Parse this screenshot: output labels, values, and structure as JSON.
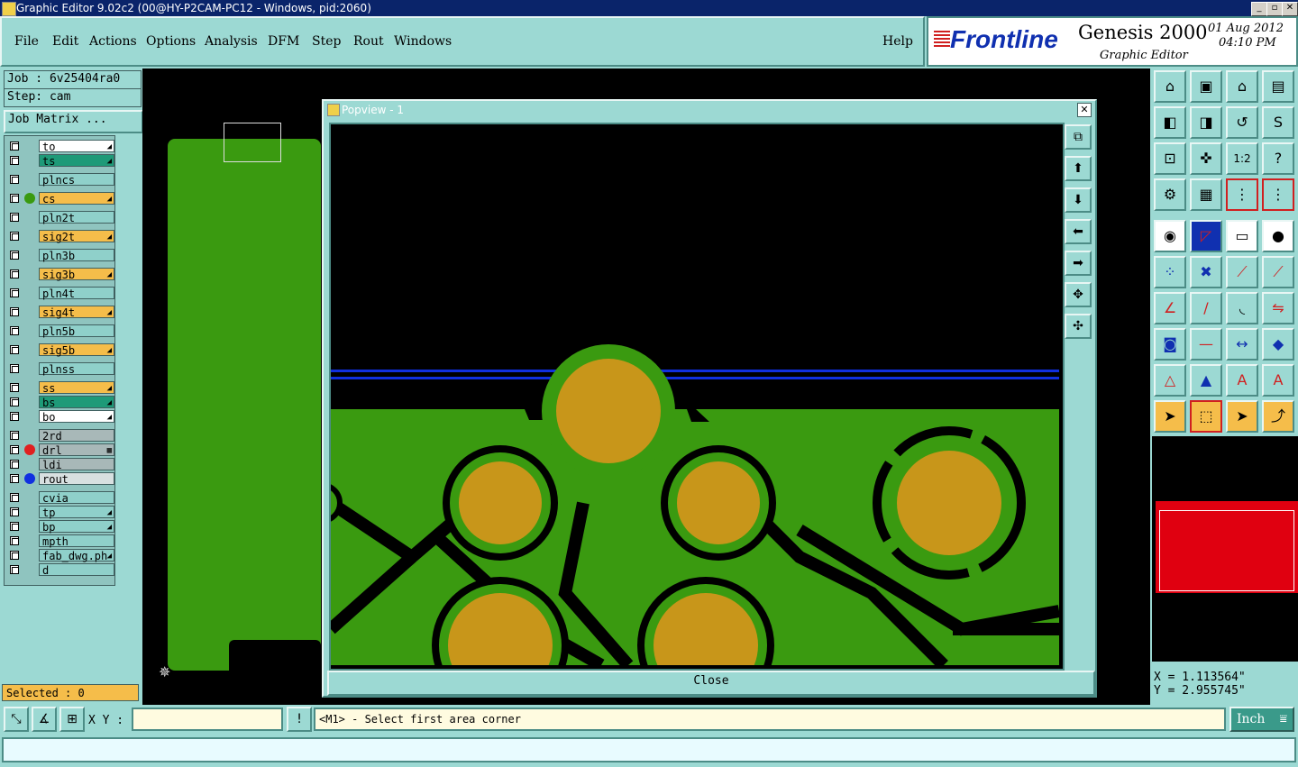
{
  "window": {
    "title": "Graphic Editor 9.02c2 (00@HY-P2CAM-PC12 - Windows, pid:2060)"
  },
  "menu": [
    "File",
    "Edit",
    "Actions",
    "Options",
    "Analysis",
    "DFM",
    "Step",
    "Rout",
    "Windows"
  ],
  "help_label": "Help",
  "brand": {
    "logo": "Frontline",
    "product": "Genesis 2000",
    "subtitle": "Graphic Editor",
    "date": "01 Aug 2012",
    "time": "04:10 PM"
  },
  "job": {
    "job_line": "Job : 6v25404ra0",
    "step_line": "Step: cam",
    "matrix_label": "Job Matrix ..."
  },
  "layers": [
    {
      "name": "to",
      "bg": "#ffffff",
      "dot": "",
      "mark": "◢"
    },
    {
      "name": "ts",
      "bg": "#1e9a78",
      "dot": "",
      "mark": "◢"
    },
    {
      "name": "plncs",
      "bg": "#8fd0ca",
      "dot": "",
      "mark": ""
    },
    {
      "name": "cs",
      "bg": "#f5bd4a",
      "dot": "#3a9a10",
      "mark": "◢"
    },
    {
      "name": "pln2t",
      "bg": "#8fd0ca",
      "dot": "",
      "mark": ""
    },
    {
      "name": "sig2t",
      "bg": "#f5bd4a",
      "dot": "",
      "mark": "◢"
    },
    {
      "name": "pln3b",
      "bg": "#8fd0ca",
      "dot": "",
      "mark": ""
    },
    {
      "name": "sig3b",
      "bg": "#f5bd4a",
      "dot": "",
      "mark": "◢"
    },
    {
      "name": "pln4t",
      "bg": "#8fd0ca",
      "dot": "",
      "mark": ""
    },
    {
      "name": "sig4t",
      "bg": "#f5bd4a",
      "dot": "",
      "mark": "◢"
    },
    {
      "name": "pln5b",
      "bg": "#8fd0ca",
      "dot": "",
      "mark": ""
    },
    {
      "name": "sig5b",
      "bg": "#f5bd4a",
      "dot": "",
      "mark": "◢"
    },
    {
      "name": "plnss",
      "bg": "#8fd0ca",
      "dot": "",
      "mark": ""
    },
    {
      "name": "ss",
      "bg": "#f5bd4a",
      "dot": "",
      "mark": "◢"
    },
    {
      "name": "bs",
      "bg": "#1e9a78",
      "dot": "",
      "mark": "◢"
    },
    {
      "name": "bo",
      "bg": "#ffffff",
      "dot": "",
      "mark": "◢"
    },
    {
      "name": "2rd",
      "bg": "#a8b8b8",
      "dot": "",
      "mark": ""
    },
    {
      "name": "drl",
      "bg": "#a8b8b8",
      "dot": "#e02020",
      "mark": "▦"
    },
    {
      "name": "ldi",
      "bg": "#a8b8b8",
      "dot": "",
      "mark": ""
    },
    {
      "name": "rout",
      "bg": "#d8e0e0",
      "dot": "#1030e0",
      "mark": ""
    },
    {
      "name": "cvia",
      "bg": "#8fd0ca",
      "dot": "",
      "mark": ""
    },
    {
      "name": "tp",
      "bg": "#8fd0ca",
      "dot": "",
      "mark": "◢"
    },
    {
      "name": "bp",
      "bg": "#8fd0ca",
      "dot": "",
      "mark": "◢"
    },
    {
      "name": "mpth",
      "bg": "#8fd0ca",
      "dot": "",
      "mark": ""
    },
    {
      "name": "fab_dwg.ph",
      "bg": "#8fd0ca",
      "dot": "",
      "mark": "◢"
    },
    {
      "name": "d",
      "bg": "#8fd0ca",
      "dot": "",
      "mark": ""
    }
  ],
  "selected": "Selected : 0",
  "popup": {
    "title": "Popview - 1",
    "close_label": "Close"
  },
  "coords": {
    "x": "X = 1.113564\"",
    "y": "Y = 2.955745\""
  },
  "xy_label": "X Y :",
  "status_message": "<M1> - Select first area corner",
  "unit": "Inch",
  "colors": {
    "board": "#3a9a10",
    "pad": "#c8961a",
    "trace": "#1030e0",
    "panel": "#9cd9d3",
    "highlight": "#f5bd4a"
  }
}
